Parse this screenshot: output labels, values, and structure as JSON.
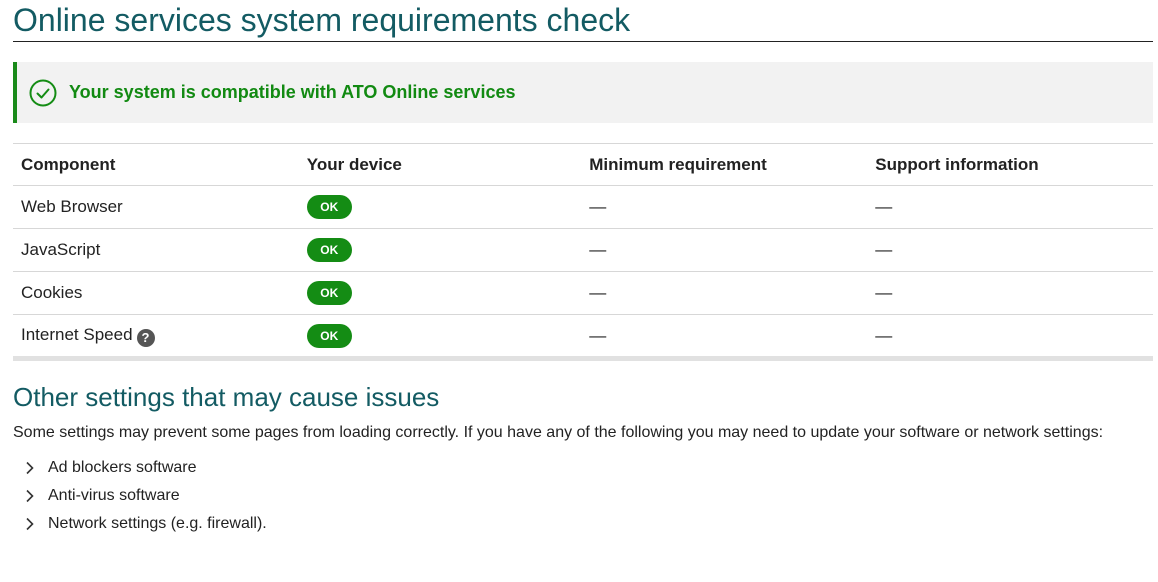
{
  "page": {
    "title": "Online services system requirements check"
  },
  "alert": {
    "icon": "check-circle-icon",
    "message": "Your system is compatible with ATO Online services",
    "accent_color": "#148c14"
  },
  "table": {
    "headers": [
      "Component",
      "Your device",
      "Minimum requirement",
      "Support information"
    ],
    "rows": [
      {
        "component": "Web Browser",
        "device": "OK",
        "minimum": "—",
        "support": "—"
      },
      {
        "component": "JavaScript",
        "device": "OK",
        "minimum": "—",
        "support": "—"
      },
      {
        "component": "Cookies",
        "device": "OK",
        "minimum": "—",
        "support": "—"
      },
      {
        "component": "Internet Speed",
        "device": "OK",
        "minimum": "—",
        "support": "—",
        "help_icon": "?"
      }
    ]
  },
  "other_settings": {
    "title": "Other settings that may cause issues",
    "intro": "Some settings may prevent some pages from loading correctly. If you have any of the following you may need to update your software or network settings:",
    "items": [
      "Ad blockers software",
      "Anti-virus software",
      "Network settings (e.g. firewall)."
    ]
  },
  "colors": {
    "heading": "#135b63",
    "ok_badge": "#148c14",
    "alert_bg": "#f2f2f2"
  }
}
